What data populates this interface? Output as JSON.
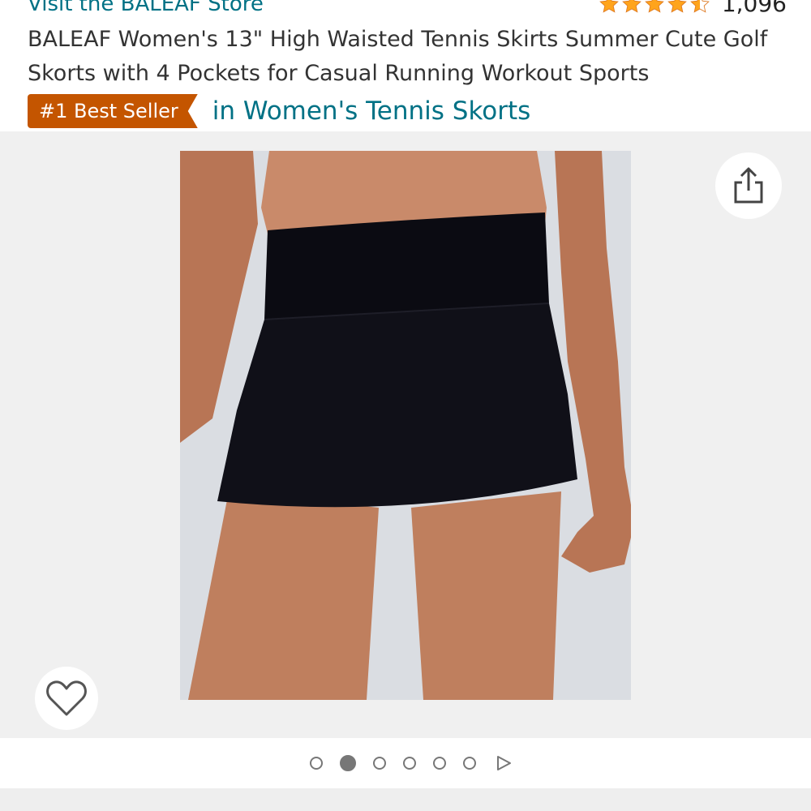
{
  "header": {
    "store_link": "Visit the BALEAF Store",
    "rating_count": "1,096",
    "rating_value_stars": 4.5,
    "star_color": "#ffa41c"
  },
  "product": {
    "title": "BALEAF Women's 13\" High Waisted Tennis Skirts Summer Cute Golf Skorts with 4 Pockets for Casual Running Workout Sports",
    "badge_label": "#1 Best Seller",
    "badge_category": "in Women's Tennis Skorts",
    "badge_color": "#c45500",
    "link_color": "#007185"
  },
  "gallery": {
    "image_count": 6,
    "active_index": 1,
    "share_icon": "share-icon",
    "favorite_icon": "heart-outline-icon",
    "video_icon": "play-icon"
  }
}
